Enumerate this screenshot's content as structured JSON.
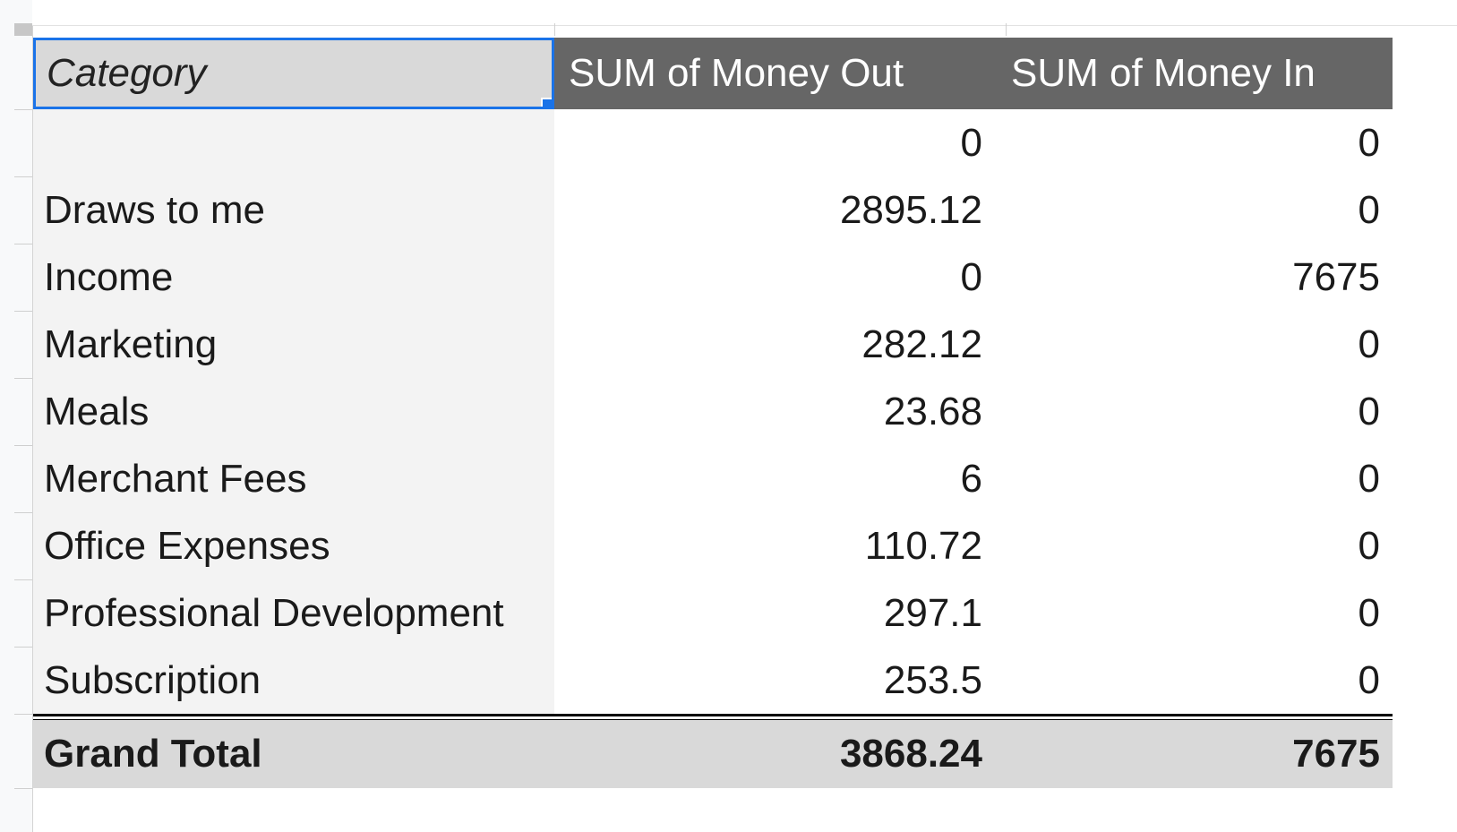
{
  "pivot": {
    "headers": {
      "category": "Category",
      "money_out": "SUM of Money Out",
      "money_in": "SUM of Money In"
    },
    "rows": [
      {
        "category": "",
        "money_out": "0",
        "money_in": "0"
      },
      {
        "category": "Draws to me",
        "money_out": "2895.12",
        "money_in": "0"
      },
      {
        "category": "Income",
        "money_out": "0",
        "money_in": "7675"
      },
      {
        "category": "Marketing",
        "money_out": "282.12",
        "money_in": "0"
      },
      {
        "category": "Meals",
        "money_out": "23.68",
        "money_in": "0"
      },
      {
        "category": "Merchant Fees",
        "money_out": "6",
        "money_in": "0"
      },
      {
        "category": "Office Expenses",
        "money_out": "110.72",
        "money_in": "0"
      },
      {
        "category": "Professional Development",
        "money_out": "297.1",
        "money_in": "0"
      },
      {
        "category": "Subscription",
        "money_out": "253.5",
        "money_in": "0"
      }
    ],
    "total": {
      "label": "Grand Total",
      "money_out": "3868.24",
      "money_in": "7675"
    }
  },
  "colors": {
    "selection": "#1a73e8",
    "header_bg": "#666666",
    "category_bg": "#f3f3f3",
    "total_bg": "#d9d9d9"
  }
}
